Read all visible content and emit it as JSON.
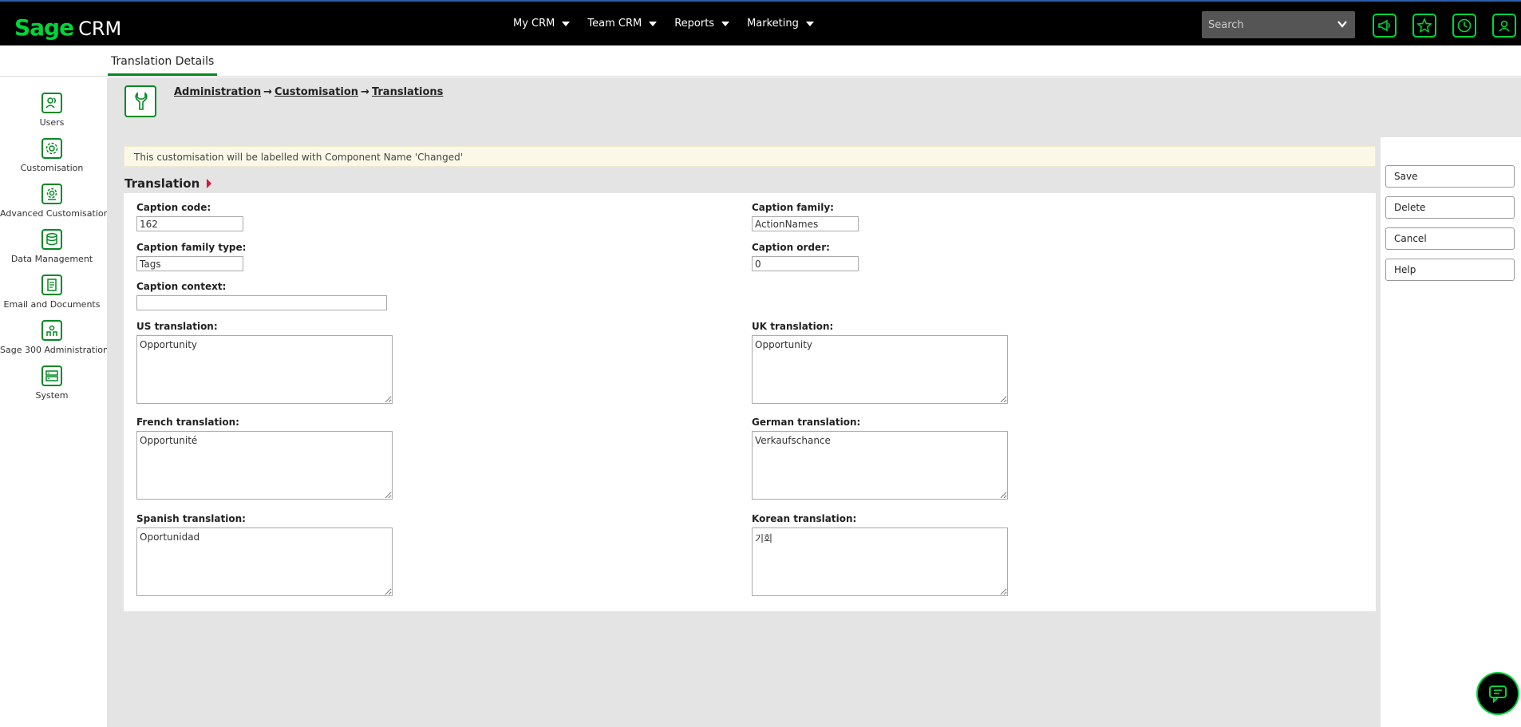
{
  "app": {
    "logo_brand": "Sage",
    "logo_product": "CRM"
  },
  "nav": [
    {
      "label": "My CRM"
    },
    {
      "label": "Team CRM"
    },
    {
      "label": "Reports"
    },
    {
      "label": "Marketing"
    }
  ],
  "search": {
    "placeholder": "Search"
  },
  "toolbar_icons": [
    "megaphone-icon",
    "star-icon",
    "clock-icon",
    "user-icon"
  ],
  "tab": {
    "label": "Translation Details"
  },
  "sidebar": {
    "items": [
      {
        "label": "Users",
        "icon": "users-icon"
      },
      {
        "label": "Customisation",
        "icon": "gear-icon"
      },
      {
        "label": "Advanced Customisation",
        "icon": "advanced-gear-icon"
      },
      {
        "label": "Data Management",
        "icon": "database-icon"
      },
      {
        "label": "Email and Documents",
        "icon": "document-icon"
      },
      {
        "label": "Sage 300 Administration",
        "icon": "admin-icon"
      },
      {
        "label": "System",
        "icon": "system-icon"
      }
    ]
  },
  "breadcrumb": {
    "items": [
      "Administration",
      "Customisation",
      "Translations"
    ],
    "separator": "→"
  },
  "notice": {
    "text": "This customisation will be labelled with Component Name 'Changed'"
  },
  "section": {
    "title": "Translation"
  },
  "fields": {
    "caption_code": {
      "label": "Caption code:",
      "value": "162"
    },
    "caption_family": {
      "label": "Caption family:",
      "value": "ActionNames"
    },
    "caption_family_type": {
      "label": "Caption family type:",
      "value": "Tags"
    },
    "caption_order": {
      "label": "Caption order:",
      "value": "0"
    },
    "caption_context": {
      "label": "Caption context:",
      "value": ""
    },
    "us_translation": {
      "label": "US translation:",
      "value": "Opportunity"
    },
    "uk_translation": {
      "label": "UK translation:",
      "value": "Opportunity"
    },
    "french_translation": {
      "label": "French translation:",
      "value": "Opportunité"
    },
    "german_translation": {
      "label": "German translation:",
      "value": "Verkaufschance"
    },
    "spanish_translation": {
      "label": "Spanish translation:",
      "value": "Oportunidad"
    },
    "korean_translation": {
      "label": "Korean translation:",
      "value": "기회"
    }
  },
  "actions": {
    "save": "Save",
    "delete": "Delete",
    "cancel": "Cancel",
    "help": "Help"
  },
  "colors": {
    "brand_green": "#00d639",
    "icon_green": "#008a21",
    "topbar": "#000000",
    "accent_red": "#d9143a"
  }
}
